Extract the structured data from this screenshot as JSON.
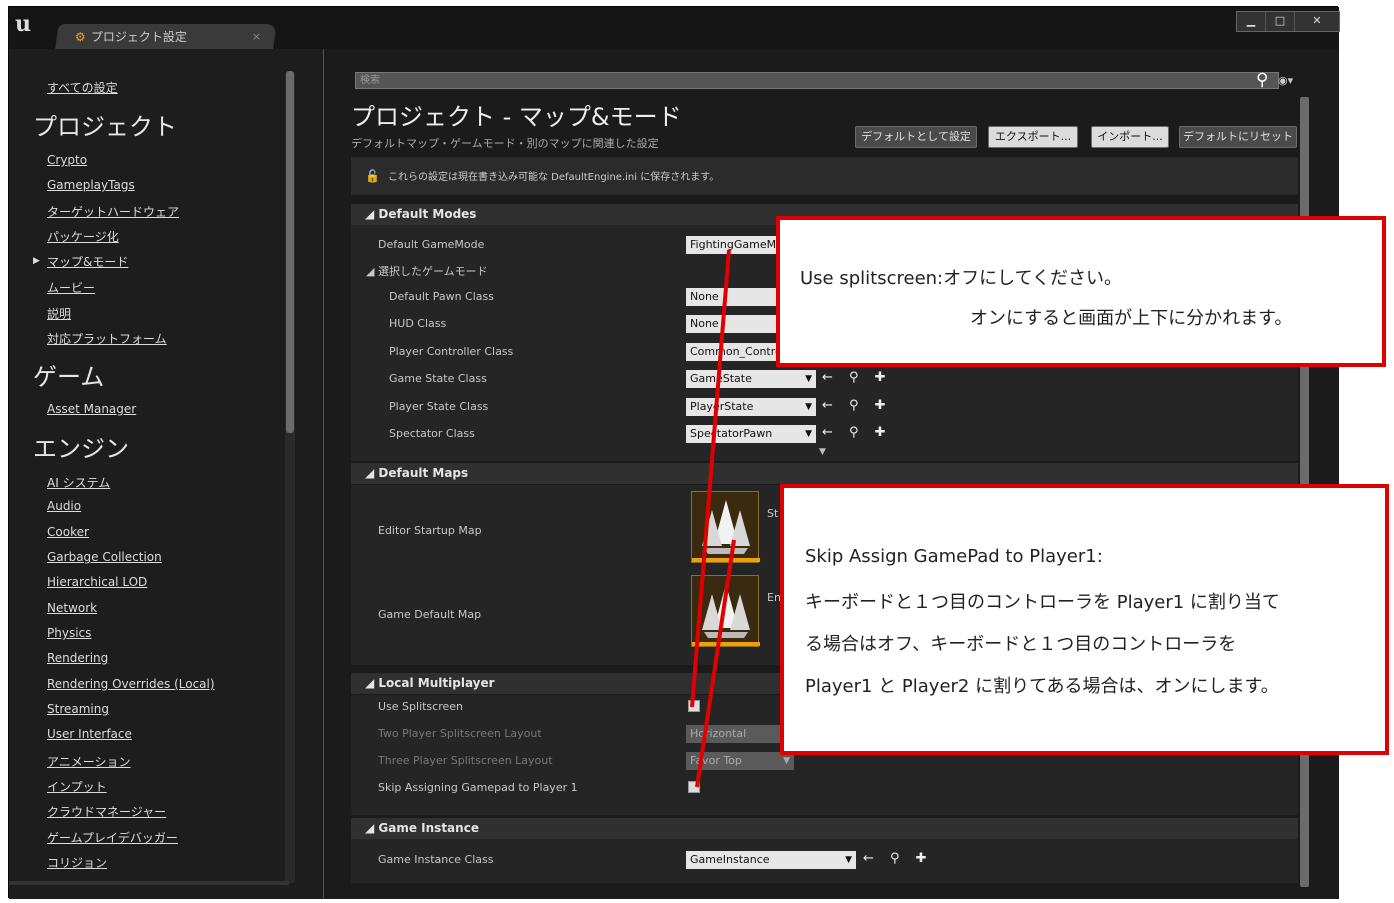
{
  "window": {
    "logo": "u",
    "tab_title": "プロジェクト設定",
    "tab_close": "×",
    "buttons": {
      "minimize": "▁",
      "maximize": "□",
      "close": "✕"
    }
  },
  "sidebar": {
    "all_settings": "すべての設定",
    "project_header": "プロジェクト",
    "project_items": [
      "Crypto",
      "GameplayTags",
      "ターゲットハードウェア",
      "パッケージ化",
      "マップ&モード",
      "ムービー",
      "説明",
      "対応プラットフォーム"
    ],
    "selected_marker": "▶",
    "game_header": "ゲーム",
    "game_items": [
      "Asset Manager"
    ],
    "engine_header": "エンジン",
    "engine_items": [
      "AI システム",
      "Audio",
      "Cooker",
      "Garbage Collection",
      "Hierarchical LOD",
      "Network",
      "Physics",
      "Rendering",
      "Rendering Overrides (Local)",
      "Streaming",
      "User Interface",
      "アニメーション",
      "インプット",
      "クラウドマネージャー",
      "ゲームプレイデバッガー",
      "コリジョン"
    ]
  },
  "main": {
    "search_placeholder": "検索",
    "title": "プロジェクト - マップ&モード",
    "subtitle": "デフォルトマップ・ゲームモード・別のマップに関連した設定",
    "buttons": [
      "デフォルトとして設定",
      "エクスポート...",
      "インポート...",
      "デフォルトにリセット"
    ],
    "info": "これらの設定は現在書き込み可能な DefaultEngine.ini に保存されます。",
    "sections": {
      "default_modes": "◢ Default Modes",
      "default_maps": "◢ Default Maps",
      "local_multiplayer": "◢ Local Multiplayer",
      "game_instance": "◢ Game Instance"
    },
    "default_modes": {
      "default_gamemode_label": "Default GameMode",
      "default_gamemode_value": "FightingGameMo",
      "selected_gamemode_label": "◢ 選択したゲームモード",
      "rows": [
        {
          "label": "Default Pawn Class",
          "value": "None"
        },
        {
          "label": "HUD Class",
          "value": "None"
        },
        {
          "label": "Player Controller Class",
          "value": "Common_Contro"
        },
        {
          "label": "Game State Class",
          "value": "GameState"
        },
        {
          "label": "Player State Class",
          "value": "PlayerState"
        },
        {
          "label": "Spectator Class",
          "value": "SpectatorPawn"
        }
      ],
      "icons": "← ⚲ ✚",
      "expand_arrow": "▼"
    },
    "default_maps": {
      "editor_startup_label": "Editor Startup Map",
      "editor_startup_value": "St",
      "game_default_label": "Game Default Map",
      "game_default_value": "En"
    },
    "local_multiplayer": {
      "use_splitscreen": "Use Splitscreen",
      "two_player_layout": "Two Player Splitscreen Layout",
      "two_player_value": "Horizontal",
      "three_player_layout": "Three Player Splitscreen Layout",
      "three_player_value": "Favor Top",
      "skip_gamepad": "Skip Assigning Gamepad to Player 1"
    },
    "game_instance": {
      "label": "Game Instance Class",
      "value": "GameInstance",
      "icons": "← ⚲ ✚"
    }
  },
  "callouts": {
    "first": {
      "line1": "Use splitscreen:オフにしてください。",
      "line2": "オンにすると画面が上下に分かれます。"
    },
    "second": {
      "line1": "Skip Assign GamePad to Player1:",
      "line2": "キーボードと１つ目のコントローラを Player1 に割り当て",
      "line3": "る場合はオフ、キーボードと１つ目のコントローラを",
      "line4": "Player1 と Player2 に割りてある場合は、オンにします。"
    }
  },
  "colors": {
    "callout_border": "#e00000",
    "thumb_accent": "#f0a000"
  }
}
